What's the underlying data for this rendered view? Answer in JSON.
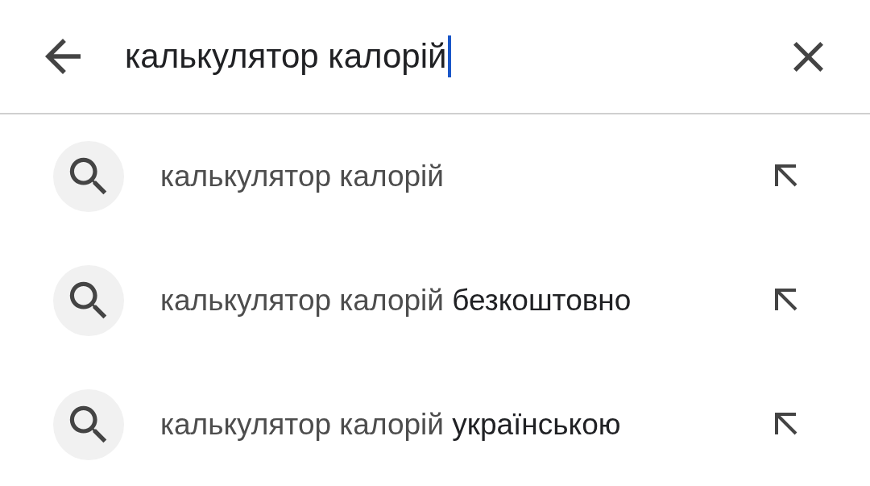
{
  "search_bar": {
    "value": "калькулятор калорій",
    "focused": true
  },
  "suggestions": [
    {
      "matched": "калькулятор калорій"
    },
    {
      "matched": "калькулятор калорій",
      "completion": "безкоштовно"
    },
    {
      "matched": "калькулятор калорій",
      "completion": "українською"
    }
  ]
}
